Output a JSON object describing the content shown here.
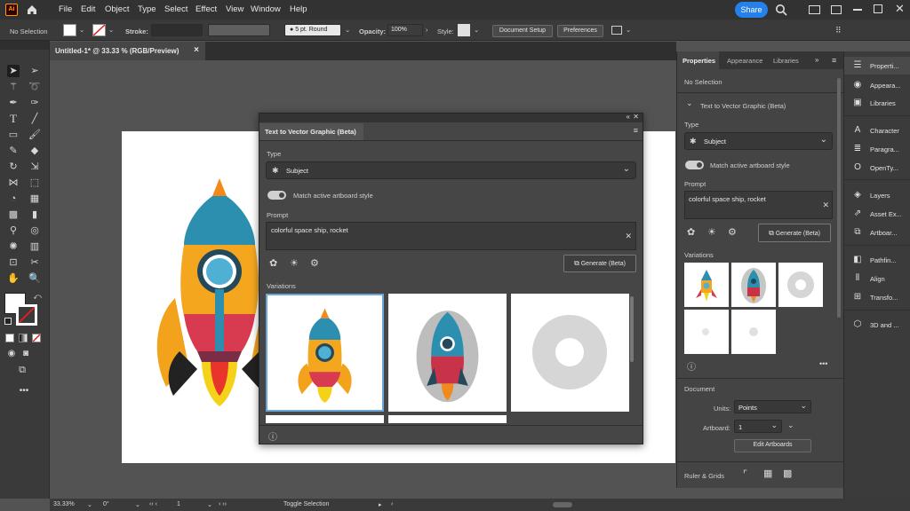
{
  "menu": [
    "File",
    "Edit",
    "Object",
    "Type",
    "Select",
    "Effect",
    "View",
    "Window",
    "Help"
  ],
  "app_logo": "Ai",
  "share_label": "Share",
  "control": {
    "selection": "No Selection",
    "stroke_label": "Stroke:",
    "brush": "5 pt. Round",
    "opacity_label": "Opacity:",
    "opacity_value": "100%",
    "style_label": "Style:",
    "doc_setup": "Document Setup",
    "preferences": "Preferences"
  },
  "doc_tab": {
    "title": "Untitled-1* @ 33.33 % (RGB/Preview)",
    "close": "×"
  },
  "dialog": {
    "title": "Text to Vector Graphic (Beta)",
    "type_label": "Type",
    "type_value": "Subject",
    "match_label": "Match active artboard style",
    "prompt_label": "Prompt",
    "prompt_value": "colorful space ship, rocket",
    "generate": "Generate (Beta)",
    "variations_label": "Variations"
  },
  "panel": {
    "tabs": [
      "Properties",
      "Appearance",
      "Libraries"
    ],
    "no_selection": "No Selection",
    "section": "Text to Vector Graphic (Beta)",
    "type_label": "Type",
    "type_value": "Subject",
    "match_label": "Match active artboard style",
    "prompt_label": "Prompt",
    "prompt_value": "colorful space ship, rocket",
    "generate": "Generate (Beta)",
    "variations_label": "Variations",
    "document_label": "Document",
    "units_label": "Units:",
    "units_value": "Points",
    "artboard_label": "Artboard:",
    "artboard_value": "1",
    "edit_artboards": "Edit Artboards",
    "rulers": "Ruler & Grids"
  },
  "sidebar": [
    "Properti...",
    "Appeara...",
    "Libraries",
    "Character",
    "Paragra...",
    "OpenTy...",
    "Layers",
    "Asset Ex...",
    "Artboar...",
    "Pathfin...",
    "Align",
    "Transfo...",
    "3D and ..."
  ],
  "status": {
    "zoom": "33.33%",
    "angle": "0°",
    "artboard": "1",
    "mode": "Toggle Selection"
  },
  "colors": {
    "accent": "#2680eb",
    "menubar": "#323232",
    "panel": "#444444"
  }
}
